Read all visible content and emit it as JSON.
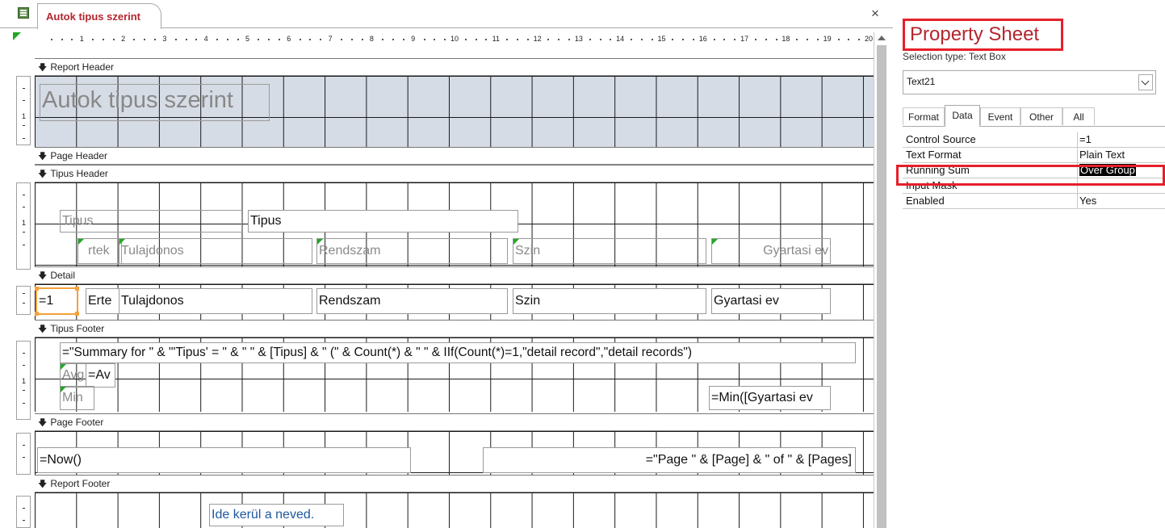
{
  "window": {
    "tab_title": "Autok tipus szerint",
    "close_glyph": "×",
    "object_icon": "report-icon"
  },
  "ruler": {
    "numbers": [
      "1",
      "2",
      "3",
      "4",
      "5",
      "6",
      "7",
      "8",
      "9",
      "10",
      "11",
      "12",
      "13",
      "14",
      "15",
      "16",
      "17",
      "18",
      "19",
      "20"
    ],
    "left_numbers": [
      "1",
      "1",
      "1"
    ]
  },
  "sections": {
    "report_header": "Report Header",
    "page_header": "Page Header",
    "tipus_header": "Tipus Header",
    "detail": "Detail",
    "tipus_footer": "Tipus Footer",
    "page_footer": "Page Footer",
    "report_footer": "Report Footer",
    "arrow_glyph": "🡇"
  },
  "controls": {
    "report_title": "Autok tipus szerint",
    "tipus_label": "Tipus",
    "tipus_field": "Tipus",
    "hdr_ertek": "rtek",
    "hdr_tulajdonos": "Tulajdonos",
    "hdr_rendszam": "Rendszam",
    "hdr_szin": "Szin",
    "hdr_gyartasi": "Gyartasi ev",
    "det_counter": "=1",
    "det_ertek": "Erte",
    "det_tulajdonos": "Tulajdonos",
    "det_rendszam": "Rendszam",
    "det_szin": "Szin",
    "det_gyartasi": "Gyartasi ev",
    "summary_expr": "=\"Summary for \" & \"'Tipus' = \" & \" \" & [Tipus] & \" (\" & Count(*) & \" \" & IIf(Count(*)=1,\"detail record\",\"detail records\")",
    "avg_label": "Avg",
    "avg_expr": "=Av",
    "min_label": "Min",
    "min_expr": "=Min([Gyartasi ev",
    "now_expr": "=Now()",
    "page_expr": "=\"Page \" & [Page] & \" of \" & [Pages]",
    "name_box": "Ide kerül a neved."
  },
  "property_sheet": {
    "title": "Property Sheet",
    "selection_type": "Selection type:  Text Box",
    "selected_control": "Text21",
    "tabs": [
      "Format",
      "Data",
      "Event",
      "Other",
      "All"
    ],
    "active_tab": "Data",
    "rows": [
      {
        "name": "Control Source",
        "value": "=1"
      },
      {
        "name": "Text Format",
        "value": "Plain Text"
      },
      {
        "name": "Running Sum",
        "value": "Over Group"
      },
      {
        "name": "Input Mask",
        "value": ""
      },
      {
        "name": "Enabled",
        "value": "Yes"
      }
    ]
  },
  "colors": {
    "accent_red": "#e5202a",
    "title_red": "#b4262e",
    "header_fill": "#d6dce5",
    "selection_orange": "#f4a13a",
    "error_green": "#22a826"
  }
}
